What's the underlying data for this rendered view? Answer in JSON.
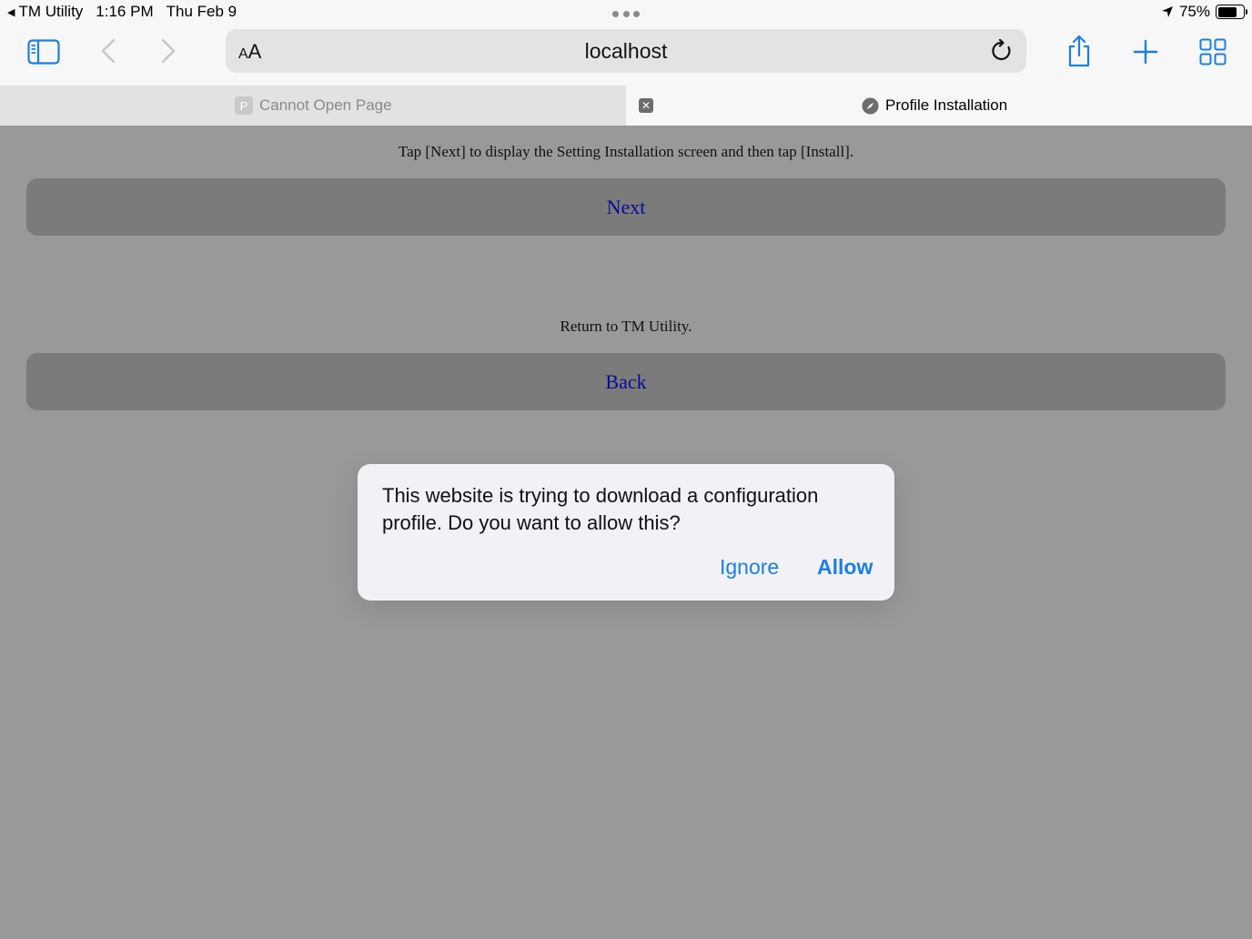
{
  "status_bar": {
    "back_app": "TM Utility",
    "time": "1:16 PM",
    "date": "Thu Feb 9",
    "battery_percent": "75%",
    "battery_level": 0.75
  },
  "toolbar": {
    "aa_small": "A",
    "aa_large": "A",
    "url": "localhost",
    "accent_color": "#1b7ee6"
  },
  "tabs": [
    {
      "label": "Cannot Open Page",
      "favicon_letter": "P",
      "active": false
    },
    {
      "label": "Profile Installation",
      "active": true
    }
  ],
  "page": {
    "next_instruction": "Tap [Next] to display the Setting Installation screen and then tap [Install].",
    "next_label": "Next",
    "back_instruction": "Return to TM Utility.",
    "back_label": "Back"
  },
  "alert": {
    "message": "This website is trying to download a configuration profile. Do you want to allow this?",
    "ignore_label": "Ignore",
    "allow_label": "Allow"
  }
}
